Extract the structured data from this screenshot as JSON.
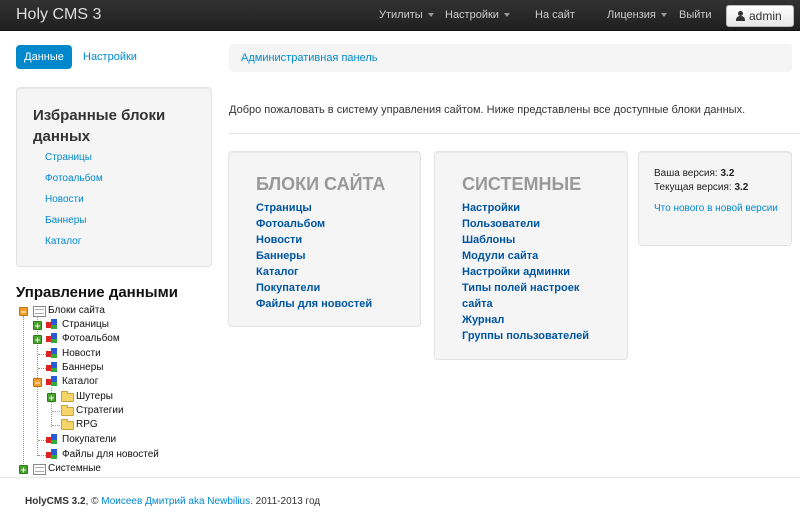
{
  "navbar": {
    "brand": "Holy CMS 3",
    "menu": {
      "utilities": "Утилиты",
      "settings": "Настройки",
      "to_site": "На сайт",
      "license": "Лицензия",
      "logout": "Выйти"
    },
    "user": "admin"
  },
  "tabs": {
    "data": "Данные",
    "settings": "Настройки"
  },
  "favorites": {
    "title": "Избранные блоки данных",
    "items": [
      "Страницы",
      "Фотоальбом",
      "Новости",
      "Баннеры",
      "Каталог"
    ]
  },
  "manage": {
    "title": "Управление данными",
    "tree": {
      "root": "Блоки сайта",
      "pages": "Страницы",
      "album": "Фотоальбом",
      "news": "Новости",
      "banners": "Баннеры",
      "catalog": "Каталог",
      "shooters": "Шутеры",
      "strategies": "Стратегии",
      "rpg": "RPG",
      "buyers": "Покупатели",
      "news_files": "Файлы для новостей",
      "system": "Системные"
    }
  },
  "breadcrumb": "Административная панель",
  "welcome": "Добро пожаловать в систему управления сайтом. Ниже представлены все доступные блоки данных.",
  "site_blocks": {
    "title": "БЛОКИ САЙТА",
    "links": [
      "Страницы",
      "Фотоальбом",
      "Новости",
      "Баннеры",
      "Каталог",
      "Покупатели",
      "Файлы для новостей"
    ]
  },
  "system_blocks": {
    "title": "СИСТЕМНЫЕ",
    "links": [
      "Настройки",
      "Пользователи",
      "Шаблоны",
      "Модули сайта",
      "Настройки админки",
      "Типы полей настроек",
      "сайта",
      "Журнал",
      "Группы пользователей"
    ]
  },
  "version": {
    "yours_label": "Ваша версия:",
    "yours_value": "3.2",
    "current_label": "Текущая версия:",
    "current_value": "3.2",
    "whats_new": "Что нового в новой версии"
  },
  "footer": {
    "product": "HolyCMS 3.2",
    "copyright": ", © ",
    "author": "Моисеев Дмитрий aka Newbilius.",
    "years": " 2011-2013 год"
  }
}
